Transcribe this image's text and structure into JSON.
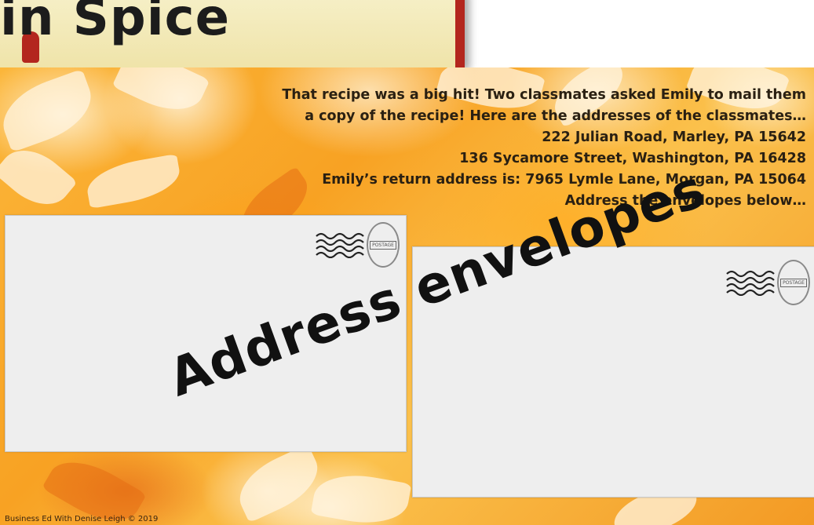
{
  "header": {
    "title_fragment": "in Spice"
  },
  "slide": {
    "lines": [
      "That recipe was a big hit!  Two classmates asked Emily to mail them",
      "a copy of the recipe! Here are the addresses of the classmates…",
      "222 Julian Road, Marley, PA  15642",
      "136 Sycamore Street, Washington, PA 16428",
      "Emily’s return address is:  7965 Lymle Lane, Morgan, PA  15064",
      "Address the envelopes below…"
    ],
    "overlay_text": "Address envelopes",
    "footer": "Business Ed With Denise Leigh © 2019",
    "stamp_text": "POSTAGE"
  },
  "colors": {
    "accent_red": "#b3261e",
    "background_orange": "#f8a223",
    "envelope_gray": "#eeeeee",
    "text_dark": "#2a2012"
  },
  "icons": [
    "postmark-wavy-lines-icon",
    "stamp-circle-icon"
  ]
}
